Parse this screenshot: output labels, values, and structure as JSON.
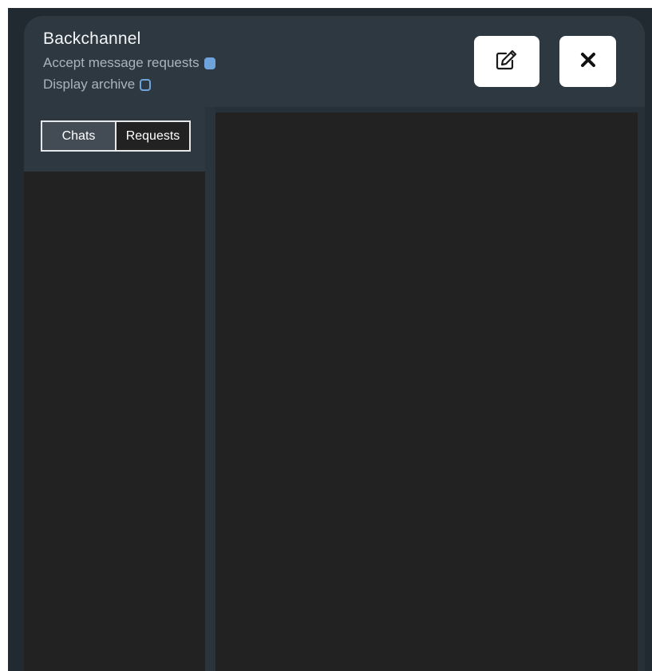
{
  "dialog": {
    "title": "Backchannel",
    "options": {
      "accept_requests_label": "Accept message requests",
      "accept_requests_checked": true,
      "display_archive_label": "Display archive",
      "display_archive_checked": false
    },
    "buttons": {
      "compose_icon": "edit-icon",
      "close_icon": "close-icon"
    }
  },
  "sidebar": {
    "tabs": [
      {
        "label": "Chats",
        "active": true
      },
      {
        "label": "Requests",
        "active": false
      }
    ]
  },
  "colors": {
    "accent": "#6fa3dc",
    "header_bg": "#2d3841",
    "content_bg": "#222222"
  }
}
